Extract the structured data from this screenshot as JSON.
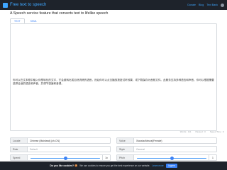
{
  "header": {
    "title": "Free text to speech",
    "nav": [
      "Donate",
      "Blog",
      "Text Bank"
    ],
    "user_icon": "user-icon"
  },
  "subtitle": "A Speech service feature that converts text to lifelike speech",
  "tabs": [
    "TEXT",
    "SSML"
  ],
  "editor": {
    "text": "你可以在文本框中输入你想转化的文字，它会被转化成自然流畅的语音，然后你可以点击播放按钮试听效果，或下载保存为音频文件。此服务支持多种语言和声音，你可以根据需要选择合适的语言和声音，并调节语速和音调。"
  },
  "counters": {
    "words": "Words : 111",
    "paused": "Paused : 0",
    "time": "Speed Time : 0"
  },
  "controls": {
    "locale_label": "Locale",
    "locale_value": "Chinese (Mainland) [zh-CN]",
    "voice_label": "Voice",
    "voice_value": "XiaoxiaoNeural(Female)",
    "role_label": "Role",
    "role_value": "Default",
    "style_label": "Style",
    "style_value": "General",
    "speed_label": "Speed",
    "speed_value": "1x",
    "speed_level": 0.5,
    "pitch_label": "Pitch",
    "pitch_value": "1",
    "pitch_level": 0.5
  },
  "cookie": {
    "title": "Do you like cookies? 🍪",
    "text": "We use cookies to ensure you get the best experience on our website.",
    "link": "Learn more",
    "button": "I agree"
  }
}
